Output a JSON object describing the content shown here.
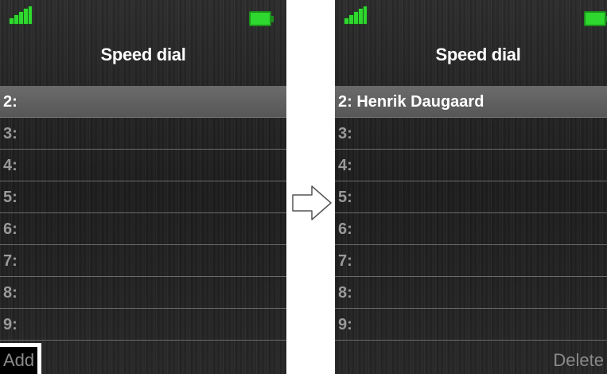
{
  "left_screen": {
    "title": "Speed dial",
    "rows": [
      {
        "num": "2:",
        "name": "",
        "selected": true
      },
      {
        "num": "3:",
        "name": ""
      },
      {
        "num": "4:",
        "name": ""
      },
      {
        "num": "5:",
        "name": ""
      },
      {
        "num": "6:",
        "name": ""
      },
      {
        "num": "7:",
        "name": ""
      },
      {
        "num": "8:",
        "name": ""
      },
      {
        "num": "9:",
        "name": ""
      }
    ],
    "softkey_left": "Add",
    "softkey_right": ""
  },
  "right_screen": {
    "title": "Speed dial",
    "rows": [
      {
        "num": "2:",
        "name": "Henrik Daugaard",
        "selected": true
      },
      {
        "num": "3:",
        "name": ""
      },
      {
        "num": "4:",
        "name": ""
      },
      {
        "num": "5:",
        "name": ""
      },
      {
        "num": "6:",
        "name": ""
      },
      {
        "num": "7:",
        "name": ""
      },
      {
        "num": "8:",
        "name": ""
      },
      {
        "num": "9:",
        "name": ""
      }
    ],
    "softkey_left": "",
    "softkey_right": "Delete"
  },
  "icons": {
    "signal": "signal-strength-icon",
    "battery": "battery-full-icon",
    "transition": "arrow-right-icon"
  },
  "colors": {
    "signal": "#2ed82e",
    "battery": "#2ed82e",
    "selected_row": "#616161",
    "text_active": "#ffffff",
    "text_inactive": "#9a9a9a"
  }
}
